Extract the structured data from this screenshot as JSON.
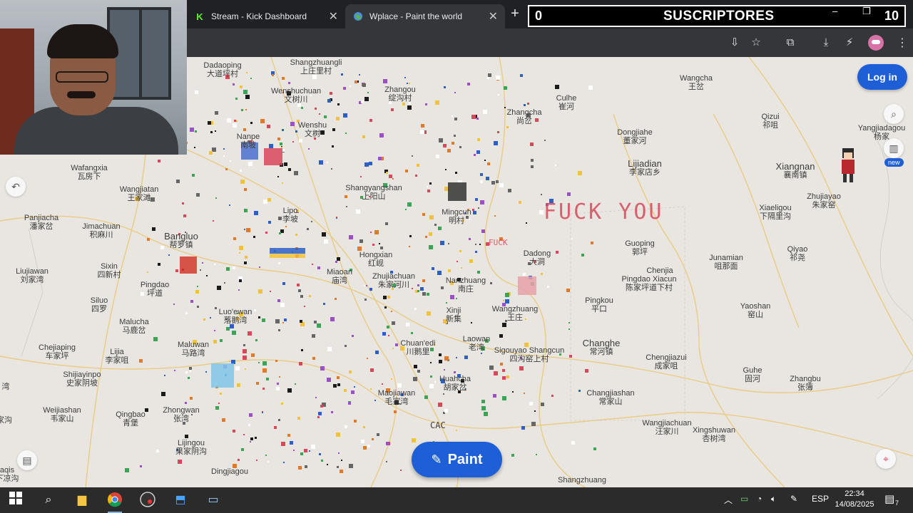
{
  "browser": {
    "tabs": [
      {
        "label": "Stream - Kick Dashboard",
        "favicon": "kick-logo",
        "color": "#53fc18"
      },
      {
        "label": "Wplace - Paint the world",
        "favicon": "globe-icon",
        "active": true
      }
    ],
    "new_tab": "+"
  },
  "overlay": {
    "count_left": "0",
    "title": "SUSCRIPTORES",
    "count_right": "10"
  },
  "window_controls": {
    "minimize": "–",
    "restore": "❐"
  },
  "toolbar_icons": [
    "install-app-icon",
    "bookmark-star-icon",
    "extensions-icon",
    "download-icon",
    "performance-icon",
    "profile-avatar"
  ],
  "map": {
    "places": [
      {
        "en": "Dadaoping",
        "cn": "大道坪村"
      },
      {
        "en": "Shangzhuangli",
        "cn": "上庄里村"
      },
      {
        "en": "Wenshuchuan",
        "cn": "文树川"
      },
      {
        "en": "Zhangou",
        "cn": "绽沟村"
      },
      {
        "en": "Culhe",
        "cn": "崔河"
      },
      {
        "en": "Wangcha",
        "cn": "王岔"
      },
      {
        "en": "Qizui",
        "cn": "祁咀"
      },
      {
        "en": "Yangjiadagou",
        "cn": "杨家"
      },
      {
        "en": "Wenshu",
        "cn": "文树"
      },
      {
        "en": "Nanpe",
        "cn": "南坡"
      },
      {
        "en": "Zhangcha",
        "cn": "尚岔"
      },
      {
        "en": "Dongjiahe",
        "cn": "董家河"
      },
      {
        "en": "Lijiadian",
        "cn": "李家店乡"
      },
      {
        "en": "Xiangnan",
        "cn": "襄南镇"
      },
      {
        "en": "Wafangxia",
        "cn": "瓦房下"
      },
      {
        "en": "Wangjiatan",
        "cn": "王家滩"
      },
      {
        "en": "Shangyangshan",
        "cn": "上阳山"
      },
      {
        "en": "Zhujiayao",
        "cn": "朱家窑"
      },
      {
        "en": "Panjiacha",
        "cn": "潘家岔"
      },
      {
        "en": "Jimachuan",
        "cn": "积麻川"
      },
      {
        "en": "Lipo",
        "cn": "李坡"
      },
      {
        "en": "Mingcun",
        "cn": "明村"
      },
      {
        "en": "Xiaeligou",
        "cn": "下隔里沟"
      },
      {
        "en": "Bangluo",
        "cn": "帮罗镇"
      },
      {
        "en": "Guoping",
        "cn": "郭坪"
      },
      {
        "en": "Qiyao",
        "cn": "祁尧"
      },
      {
        "en": "Hongxian",
        "cn": "红岘"
      },
      {
        "en": "Dadong",
        "cn": "大洞"
      },
      {
        "en": "Junamian",
        "cn": "咀那面"
      },
      {
        "en": "Liujiawan",
        "cn": "刘家湾"
      },
      {
        "en": "Sixin",
        "cn": "四新村"
      },
      {
        "en": "Miaoan",
        "cn": "庙湾"
      },
      {
        "en": "Zhujiachuan",
        "cn": "朱家河川"
      },
      {
        "en": "Nanzhuang",
        "cn": "南庄"
      },
      {
        "en": "Chenjia",
        "cn": ""
      },
      {
        "en": "Pingdao Xiacun",
        "cn": "陈家坪道下村"
      },
      {
        "en": "Pingdao",
        "cn": "坪道"
      },
      {
        "en": "Siluo",
        "cn": "四罗"
      },
      {
        "en": "Pingkou",
        "cn": "平口"
      },
      {
        "en": "Yaoshan",
        "cn": "窑山"
      },
      {
        "en": "Luo'ewan",
        "cn": "落鹅湾"
      },
      {
        "en": "Xinji",
        "cn": "新集"
      },
      {
        "en": "Wangzhuang",
        "cn": "王庄"
      },
      {
        "en": "Malucha",
        "cn": "马鹿岔"
      },
      {
        "en": "Changhe",
        "cn": "常河镇"
      },
      {
        "en": "Laowan",
        "cn": "老湾"
      },
      {
        "en": "Chejiaping",
        "cn": "车家坪"
      },
      {
        "en": "Maluwan",
        "cn": "马路湾"
      },
      {
        "en": "Chuan'edi",
        "cn": "川鹅里"
      },
      {
        "en": "Sigouyao Shangcun",
        "cn": "四沟窑上村"
      },
      {
        "en": "Lijia",
        "cn": "李家咀"
      },
      {
        "en": "Chengjiazui",
        "cn": "成家咀"
      },
      {
        "en": "Guhe",
        "cn": "固河"
      },
      {
        "en": "Zhangbu",
        "cn": "张簿"
      },
      {
        "en": "Shijiayinpo",
        "cn": "史家阴坡"
      },
      {
        "en": "Huahcha",
        "cn": "胡家岔"
      },
      {
        "en": "Changjiashan",
        "cn": "常家山"
      },
      {
        "en": "Maojiawan",
        "cn": "毛家湾"
      },
      {
        "en": "Weijiashan",
        "cn": "韦家山"
      },
      {
        "en": "Qingbao",
        "cn": "青堡"
      },
      {
        "en": "Zhongwan",
        "cn": "张湾"
      },
      {
        "en": "Wangjiachuan",
        "cn": "汪家川"
      },
      {
        "en": "Xingshuwan",
        "cn": "杏树湾"
      },
      {
        "en": "Lijingou",
        "cn": "果家阴沟"
      },
      {
        "en": "Shangzhuang",
        "cn": ""
      },
      {
        "en": "Dingjiagou",
        "cn": ""
      },
      {
        "en": "aqis",
        "cn": "下凉沟"
      },
      {
        "en": "湾",
        "cn": ""
      },
      {
        "en": "家沟",
        "cn": ""
      }
    ],
    "graffiti": [
      "FUCK YOU",
      "FUCK",
      "CAC"
    ],
    "login_label": "Log in",
    "new_badge": "new",
    "paint_label": "Paint",
    "side_icons": [
      "search-location-icon",
      "leaderboard-icon",
      "undo-icon",
      "layers-icon",
      "locate-icon"
    ]
  },
  "taskbar": {
    "icons": [
      "windows-start-icon",
      "search-icon",
      "file-explorer-icon",
      "chrome-icon",
      "obs-icon",
      "app-icon",
      "photos-icon"
    ],
    "language": "ESP",
    "time": "22:34",
    "date": "14/08/2025",
    "notification_count": "7"
  }
}
